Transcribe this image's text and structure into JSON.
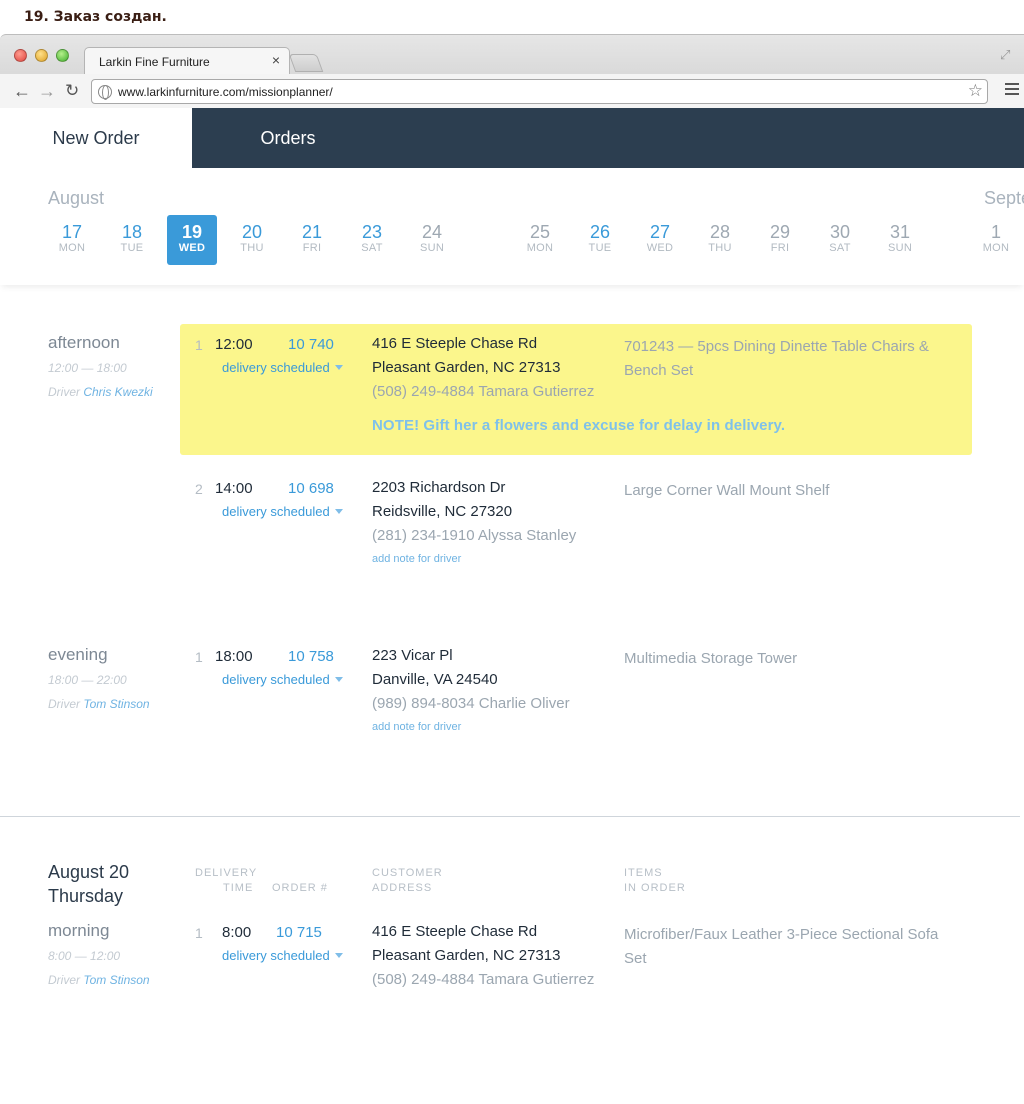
{
  "caption": "19. Заказ создан.",
  "browser": {
    "tab_title": "Larkin Fine Furniture",
    "tab_close": "×",
    "url": "www.larkinfurniture.com/missionplanner/"
  },
  "nav": {
    "new_order": "New Order",
    "orders": "Orders"
  },
  "calendar": {
    "month_current": "August",
    "month_next": "Septe",
    "days": [
      {
        "num": "17",
        "wd": "MON"
      },
      {
        "num": "18",
        "wd": "TUE"
      },
      {
        "num": "19",
        "wd": "WED"
      },
      {
        "num": "20",
        "wd": "THU"
      },
      {
        "num": "21",
        "wd": "FRI"
      },
      {
        "num": "23",
        "wd": "SAT"
      },
      {
        "num": "24",
        "wd": "SUN"
      },
      {
        "num": "25",
        "wd": "MON"
      },
      {
        "num": "26",
        "wd": "TUE"
      },
      {
        "num": "27",
        "wd": "WED"
      },
      {
        "num": "28",
        "wd": "THU"
      },
      {
        "num": "29",
        "wd": "FRI"
      },
      {
        "num": "30",
        "wd": "SAT"
      },
      {
        "num": "31",
        "wd": "SUN"
      },
      {
        "num": "1",
        "wd": "MON"
      }
    ]
  },
  "slots": {
    "afternoon": {
      "name": "afternoon",
      "time": "12:00 — 18:00",
      "driver_prefix": "Driver",
      "driver": "Chris Kwezki"
    },
    "evening": {
      "name": "evening",
      "time": "18:00 — 22:00",
      "driver_prefix": "Driver",
      "driver": "Tom Stinson"
    },
    "morning": {
      "name": "morning",
      "time": "8:00 — 12:00",
      "driver_prefix": "Driver",
      "driver": "Tom Stinson"
    }
  },
  "orders": {
    "a1": {
      "idx": "1",
      "time": "12:00",
      "num": "10 740",
      "status": "delivery scheduled",
      "addr1": "416 E Steeple Chase Rd",
      "addr2": "Pleasant Garden, NC 27313",
      "phone": "(508) 249-4884 Tamara Gutierrez",
      "items": "701243 — 5pcs Dining Dinette Table Chairs & Bench Set",
      "note": "NOTE! Gift her a flowers and excuse for delay in delivery."
    },
    "a2": {
      "idx": "2",
      "time": "14:00",
      "num": "10 698",
      "status": "delivery scheduled",
      "addr1": "2203 Richardson Dr",
      "addr2": "Reidsville, NC 27320",
      "phone": "(281) 234-1910 Alyssa Stanley",
      "items": "Large Corner Wall Mount Shelf",
      "note_link": "add note for driver"
    },
    "e1": {
      "idx": "1",
      "time": "18:00",
      "num": "10 758",
      "status": "delivery scheduled",
      "addr1": "223 Vicar Pl",
      "addr2": "Danville, VA 24540",
      "phone": "(989) 894-8034 Charlie Oliver",
      "items": "Multimedia Storage Tower",
      "note_link": "add note for driver"
    },
    "m1": {
      "idx": "1",
      "time": "8:00",
      "num": "10 715",
      "status": "delivery scheduled",
      "addr1": "416 E Steeple Chase Rd",
      "addr2": "Pleasant Garden, NC 27313",
      "phone": "(508) 249-4884 Tamara Gutierrez",
      "items": "Microfiber/Faux Leather 3-Piece Sectional Sofa Set"
    }
  },
  "day2": {
    "date": "August 20",
    "weekday": "Thursday",
    "col_delivery": "DELIVERY",
    "col_time": "TIME",
    "col_order": "ORDER #",
    "col_customer": "CUSTOMER",
    "col_address": "ADDRESS",
    "col_items": "ITEMS",
    "col_in_order": "IN ORDER"
  },
  "colors": {
    "nav_bg": "#2c3e50",
    "accent": "#3a9ad9",
    "highlight": "#fbf68c"
  }
}
